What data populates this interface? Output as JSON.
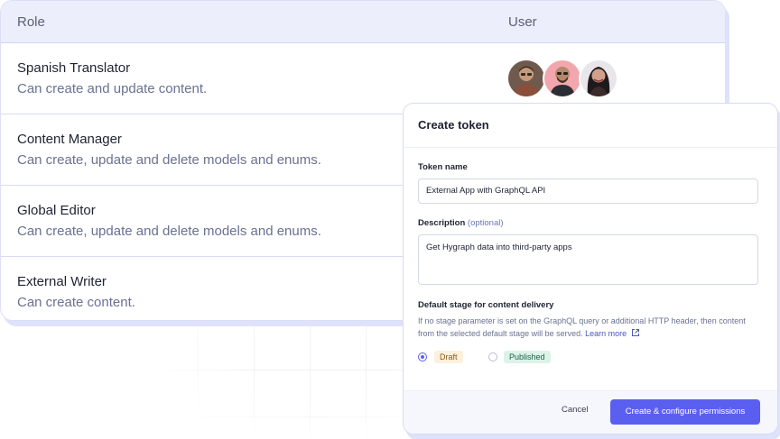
{
  "roles_table": {
    "headers": {
      "role": "Role",
      "user": "User"
    },
    "rows": [
      {
        "name": "Spanish Translator",
        "description": "Can create and update content."
      },
      {
        "name": "Content Manager",
        "description": "Can create, update and delete models and enums."
      },
      {
        "name": "Global Editor",
        "description": "Can create, update and delete models and enums."
      },
      {
        "name": "External Writer",
        "description": "Can create content."
      }
    ]
  },
  "modal": {
    "title": "Create token",
    "token_name": {
      "label": "Token name",
      "value": "External App with GraphQL API"
    },
    "description": {
      "label": "Description",
      "optional": "(optional)",
      "value": "Get Hygraph data into third-party apps"
    },
    "stage": {
      "label": "Default stage for content delivery",
      "hint": "If no stage parameter is set on the GraphQL query or additional HTTP header, then content from the selected default stage will be served.",
      "learn_more": "Learn more",
      "options": [
        {
          "label": "Draft",
          "selected": true
        },
        {
          "label": "Published",
          "selected": false
        }
      ]
    },
    "cancel_label": "Cancel",
    "submit_label": "Create & configure permissions"
  },
  "colors": {
    "accent": "#5b5ff0",
    "header_bg": "#eceefc",
    "draft_badge": "#fdf0dc",
    "published_badge": "#dcf3ea"
  }
}
